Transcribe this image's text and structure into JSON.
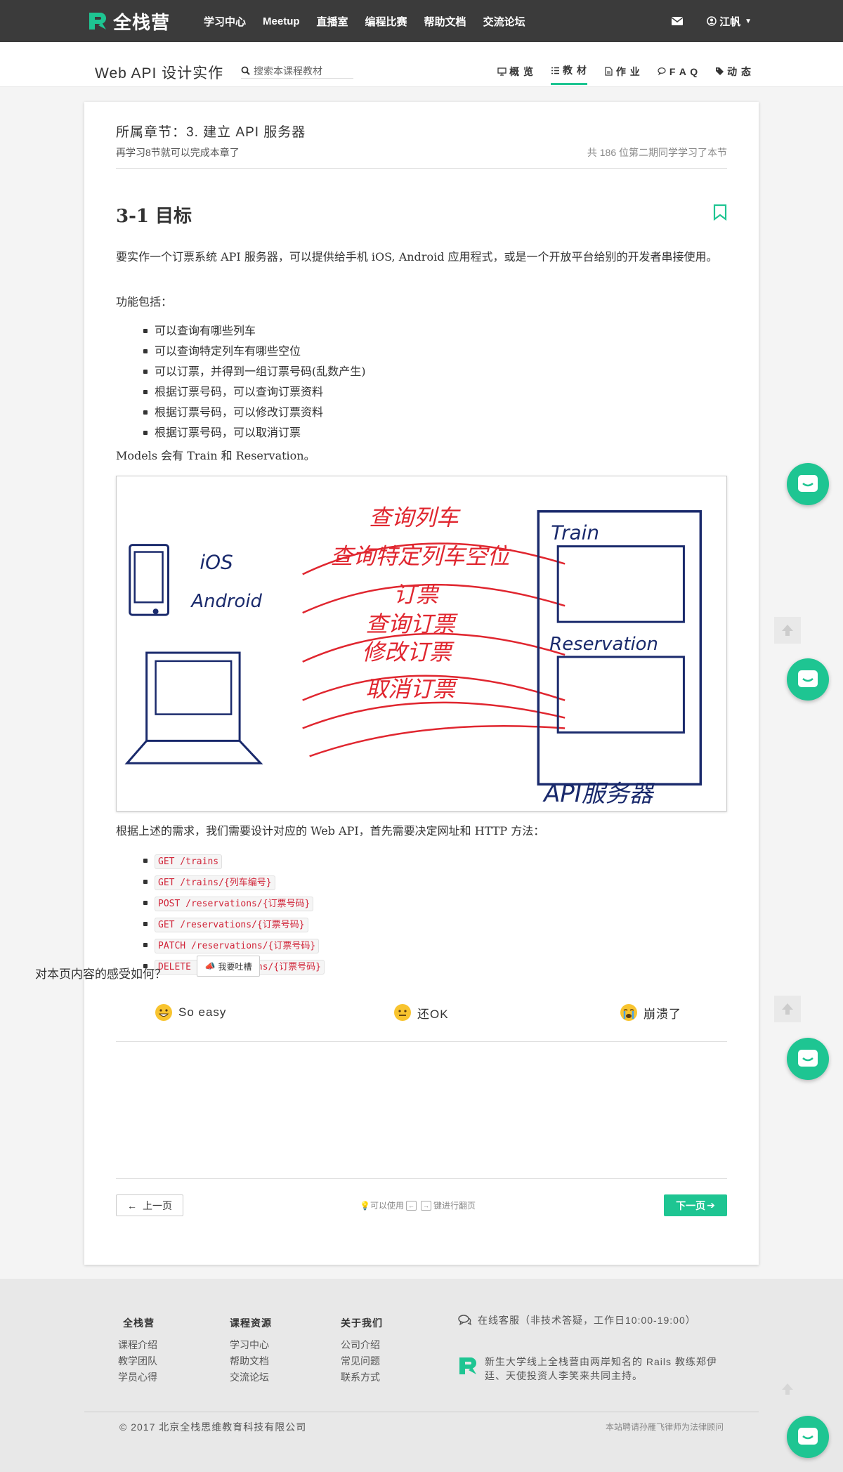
{
  "brand": {
    "name": "全栈营",
    "accent": "#1ec592"
  },
  "nav": {
    "links": [
      "学习中心",
      "Meetup",
      "直播室",
      "编程比赛",
      "帮助文档",
      "交流论坛"
    ],
    "user": "江帆"
  },
  "course": {
    "title": "Web API 设计实作",
    "search_placeholder": "搜索本课程教材",
    "tabs": [
      {
        "label": "概 览",
        "icon": "monitor-icon"
      },
      {
        "label": "教 材",
        "icon": "list-icon",
        "active": true
      },
      {
        "label": "作 业",
        "icon": "file-icon"
      },
      {
        "label": "F A Q",
        "icon": "comments-icon"
      },
      {
        "label": "动 态",
        "icon": "tags-icon"
      }
    ]
  },
  "chapter": {
    "title": "所属章节：3. 建立 API 服务器",
    "remaining": "再学习8节就可以完成本章了",
    "learners": "共 186 位第二期同学学习了本节"
  },
  "lesson": {
    "title": "3-1 目标",
    "intro": "要实作一个订票系统 API 服务器，可以提供给手机 iOS, Android 应用程式，或是一个开放平台给别的开发者串接使用。",
    "features_label": "功能包括：",
    "features": [
      "可以查询有哪些列车",
      "可以查询特定列车有哪些空位",
      "可以订票，并得到一组订票号码(乱数产生)",
      "根据订票号码，可以查询订票资料",
      "根据订票号码，可以修改订票资料",
      "根据订票号码，可以取消订票"
    ],
    "models_text": "Models 会有 Train 和 Reservation。",
    "diagram": {
      "left_labels": [
        "iOS",
        "Android"
      ],
      "actions": [
        "查询列车",
        "查询特定列车空位",
        "订票",
        "查询订票",
        "修改订票",
        "取消订票"
      ],
      "models": [
        "Train",
        "Reservation"
      ],
      "server_label": "API服务器"
    },
    "api_intro": "根据上述的需求，我们需要设计对应的 Web API，首先需要决定网址和 HTTP 方法：",
    "endpoints": [
      "GET /trains",
      "GET /trains/{列车编号}",
      "POST /reservations/{订票号码}",
      "GET /reservations/{订票号码}",
      "PATCH /reservations/{订票号码}",
      "DELETE /reservations/{订票号码}"
    ]
  },
  "feedback": {
    "question": "对本页内容的感受如何？",
    "complain_button": "我要吐槽",
    "moods": [
      "So easy",
      "还OK",
      "崩溃了"
    ]
  },
  "pager": {
    "prev": "上一页",
    "hint_prefix": "可以使用",
    "hint_suffix": "键进行翻页",
    "next": "下一页"
  },
  "footer": {
    "columns": [
      {
        "title": "全栈营",
        "links": [
          "课程介绍",
          "教学团队",
          "学员心得"
        ]
      },
      {
        "title": "课程资源",
        "links": [
          "学习中心",
          "帮助文档",
          "交流论坛"
        ]
      },
      {
        "title": "关于我们",
        "links": [
          "公司介绍",
          "常见问题",
          "联系方式"
        ]
      }
    ],
    "support": "在线客服（非技术答疑，工作日10:00-19:00）",
    "description": "新生大学线上全栈营由两岸知名的 Rails 教练郑伊廷、天使投资人李笑来共同主持。",
    "copyright": "© 2017 北京全栈思维教育科技有限公司",
    "legal": "本站聘请孙雁飞律师为法律顾问"
  }
}
